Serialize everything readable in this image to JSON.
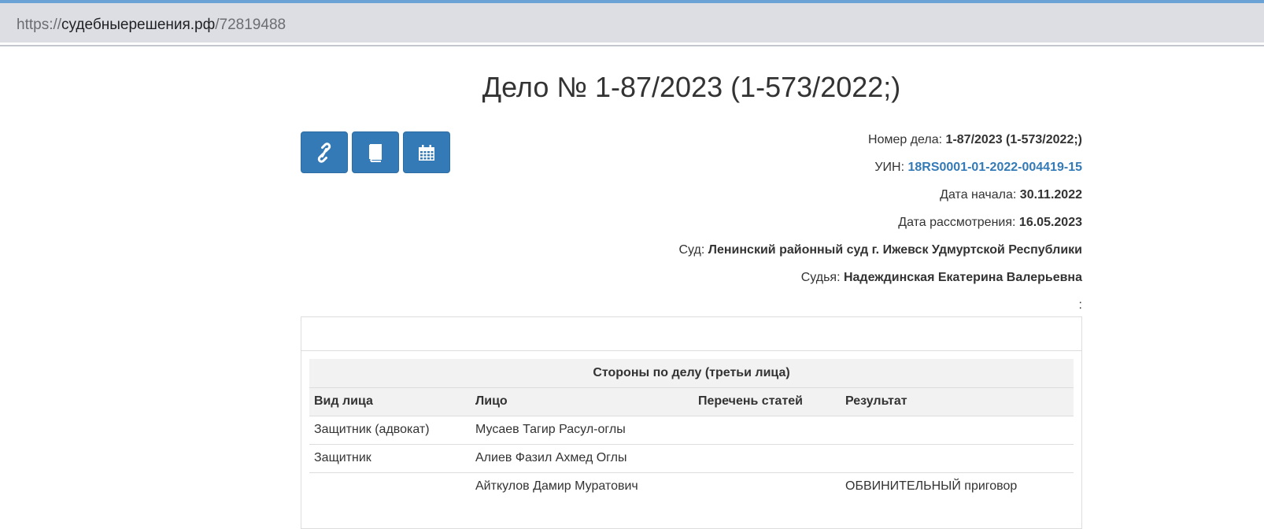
{
  "browser": {
    "url_scheme": "https://",
    "url_host": "судебныерешения.рф",
    "url_path": "/72819488"
  },
  "page": {
    "title": "Дело № 1-87/2023 (1-573/2022;)"
  },
  "toolbar": {
    "buttons": [
      {
        "icon": "link-icon"
      },
      {
        "icon": "book-icon"
      },
      {
        "icon": "calendar-icon"
      }
    ],
    "accent_color": "#337ab7"
  },
  "case_info": {
    "case_number_label": "Номер дела:",
    "case_number_value": "1-87/2023 (1-573/2022;)",
    "uin_label": "УИН:",
    "uin_value": "18RS0001-01-2022-004419-15",
    "start_date_label": "Дата начала:",
    "start_date_value": "30.11.2022",
    "review_date_label": "Дата рассмотрения:",
    "review_date_value": "16.05.2023",
    "court_label": "Суд:",
    "court_value": "Ленинский районный суд г. Ижевск Удмуртской Республики",
    "judge_label": "Судья:",
    "judge_value": "Надеждинская Екатерина Валерьевна",
    "extra_label": ":"
  },
  "parties_table": {
    "caption": "Стороны по делу (третьи лица)",
    "headers": [
      "Вид лица",
      "Лицо",
      "Перечень статей",
      "Результат"
    ],
    "rows": [
      [
        "Защитник (адвокат)",
        "Мусаев Тагир Расул-оглы",
        "",
        ""
      ],
      [
        "Защитник",
        "Алиев Фазил Ахмед Оглы",
        "",
        ""
      ],
      [
        "",
        "Айткулов Дамир Муратович",
        "",
        "ОБВИНИТЕЛЬНЫЙ приговор"
      ]
    ]
  }
}
